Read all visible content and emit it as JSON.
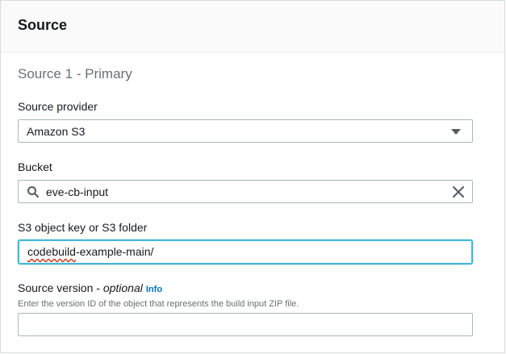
{
  "panel": {
    "title": "Source",
    "section_title": "Source 1 - Primary"
  },
  "source_provider": {
    "label": "Source provider",
    "selected": "Amazon S3",
    "icon": "chevron-down-icon"
  },
  "bucket": {
    "label": "Bucket",
    "value": "eve-cb-input",
    "icons": [
      "search-icon",
      "close-icon"
    ]
  },
  "object_key": {
    "label": "S3 object key or S3 folder",
    "value_misspelled": "codebuild",
    "value_rest": "-example-main/"
  },
  "source_version": {
    "label": "Source version - ",
    "optional": "optional",
    "info": "Info",
    "hint": "Enter the version ID of the object that represents the build input ZIP file.",
    "value": ""
  },
  "colors": {
    "focus_border": "#44b9d6",
    "link": "#0073bb",
    "muted": "#687078"
  }
}
